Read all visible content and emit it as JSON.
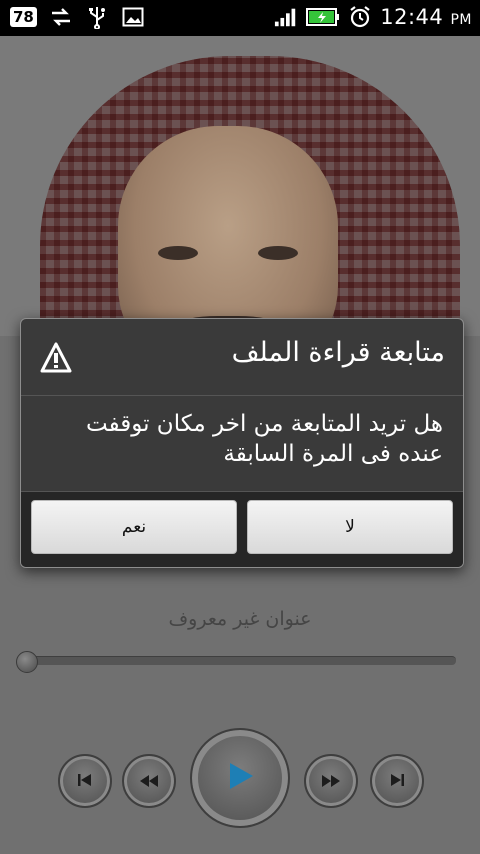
{
  "statusbar": {
    "badge": "78",
    "icons_left": [
      "sync-icon",
      "usb-icon",
      "image-icon"
    ],
    "icons_right": [
      "signal-icon",
      "battery-icon",
      "alarm-icon"
    ],
    "time": "12:44",
    "ampm": "PM"
  },
  "player": {
    "track_title": "عنوان غير معروف",
    "progress": 0,
    "controls": [
      "previous",
      "rewind",
      "play",
      "fast-forward",
      "next"
    ]
  },
  "dialog": {
    "title": "متابعة قراءة الملف",
    "message": "هل تريد المتابعة من اخر مكان توقفت عنده فى المرة السابقة",
    "yes_label": "نعم",
    "no_label": "لا"
  },
  "colors": {
    "accent": "#1e7fb5",
    "dialog_bg": "#3a3a3a",
    "button_bg": "#e8e8e8"
  }
}
